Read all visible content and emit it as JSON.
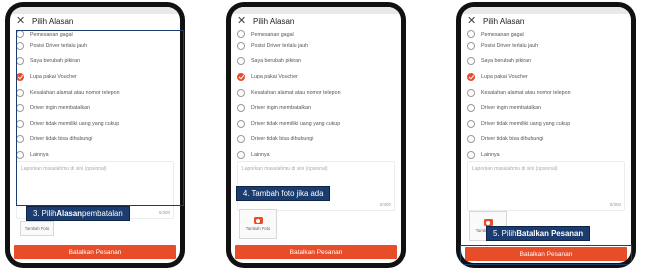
{
  "header": {
    "title": "Pilih Alasan"
  },
  "options": [
    {
      "label": "Pemesanan gagal"
    },
    {
      "label": "Posisi Driver terlalu jauh"
    },
    {
      "label": "Saya berubah pikiran"
    },
    {
      "label": "Lupa pakai Voucher",
      "selected": true
    },
    {
      "label": "Kesalahan alamat atau nomor telepon"
    },
    {
      "label": "Driver ingin membatalkan"
    },
    {
      "label": "Driver tidak memiliki uang yang cukup"
    },
    {
      "label": "Driver tidak bisa dihubungi"
    },
    {
      "label": "Lainnya"
    }
  ],
  "textarea": {
    "placeholder": "Laporkan masalahmu di sini (opsional)",
    "counter": "0/300"
  },
  "photo": {
    "label": "Tambah Foto"
  },
  "submit_label": "Batalkan Pesanan",
  "callouts": {
    "step3": {
      "prefix": "3. Pilih ",
      "bold": "Alasan",
      "suffix": " pembatalan"
    },
    "step4": {
      "text": "4. Tambah foto jika ada"
    },
    "step5": {
      "prefix": "5. Pilih ",
      "bold": "Batalkan Pesanan"
    }
  },
  "colors": {
    "accent": "#e84d2a",
    "callout": "#1b3c6e"
  },
  "icons": [
    "close-icon",
    "camera-icon"
  ]
}
